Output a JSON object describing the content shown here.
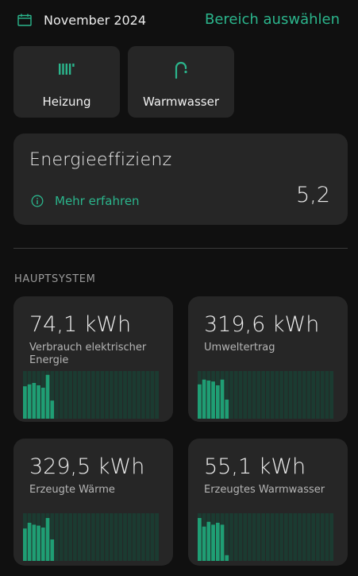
{
  "header": {
    "month": "November 2024",
    "select_range": "Bereich auswählen"
  },
  "tiles": [
    {
      "label": "Heizung",
      "icon": "radiator-icon"
    },
    {
      "label": "Warmwasser",
      "icon": "faucet-icon"
    }
  ],
  "efficiency": {
    "title": "Energieeffizienz",
    "link": "Mehr erfahren",
    "value": "5,2"
  },
  "section": {
    "title": "HAUPTSYSTEM"
  },
  "cards": [
    {
      "value": "74,1 kWh",
      "label": "Verbrauch elektrischer Energie",
      "daily": [
        0.68,
        0.72,
        0.75,
        0.7,
        0.65,
        0.92,
        0.38,
        0,
        0,
        0,
        0,
        0,
        0,
        0,
        0,
        0,
        0,
        0,
        0,
        0,
        0,
        0,
        0,
        0,
        0,
        0,
        0,
        0,
        0,
        0
      ]
    },
    {
      "value": "319,6 kWh",
      "label": "Umweltertrag",
      "daily": [
        0.72,
        0.82,
        0.8,
        0.78,
        0.7,
        0.82,
        0.4,
        0,
        0,
        0,
        0,
        0,
        0,
        0,
        0,
        0,
        0,
        0,
        0,
        0,
        0,
        0,
        0,
        0,
        0,
        0,
        0,
        0,
        0,
        0
      ]
    },
    {
      "value": "329,5 kWh",
      "label": "Erzeugte Wärme",
      "daily": [
        0.68,
        0.8,
        0.76,
        0.74,
        0.7,
        0.9,
        0.45,
        0,
        0,
        0,
        0,
        0,
        0,
        0,
        0,
        0,
        0,
        0,
        0,
        0,
        0,
        0,
        0,
        0,
        0,
        0,
        0,
        0,
        0,
        0
      ]
    },
    {
      "value": "55,1 kWh",
      "label": "Erzeugtes Warmwasser",
      "daily": [
        0.9,
        0.72,
        0.82,
        0.76,
        0.8,
        0.76,
        0.12,
        0,
        0,
        0,
        0,
        0,
        0,
        0,
        0,
        0,
        0,
        0,
        0,
        0,
        0,
        0,
        0,
        0,
        0,
        0,
        0,
        0,
        0,
        0
      ]
    }
  ],
  "colors": {
    "accent": "#2bb58c",
    "bar_fill": "#1f9e74",
    "bar_track": "#1b3b31",
    "card_bg": "#262626",
    "page_bg": "#101010"
  }
}
